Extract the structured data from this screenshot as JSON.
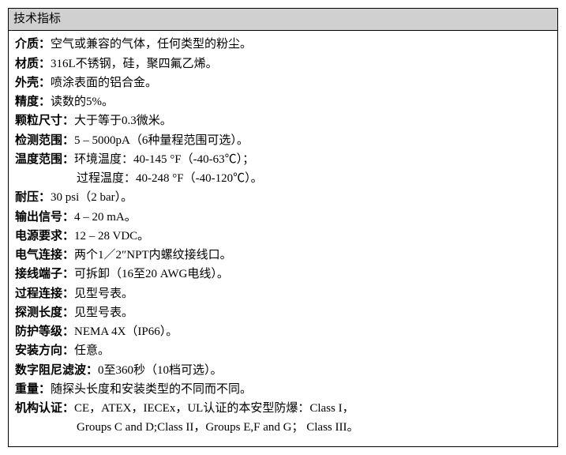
{
  "header": "技术指标",
  "specs": {
    "medium": {
      "label": "介质：",
      "value": "空气或兼容的气体，任何类型的粉尘。"
    },
    "material": {
      "label": "材质：",
      "value": "316L不锈钢，硅，聚四氟乙烯。"
    },
    "enclosure": {
      "label": "外壳：",
      "value": "喷涂表面的铝合金。"
    },
    "accuracy": {
      "label": "精度：",
      "value": "读数的5%。"
    },
    "particle": {
      "label": "颗粒尺寸：",
      "value": "大于等于0.3微米。"
    },
    "detection_range": {
      "label": "检测范围：",
      "value": "5 – 5000pA（6种量程范围可选）。"
    },
    "temp_range": {
      "label": "温度范围：",
      "value": "环境温度：40-145 °F（-40-63℃）；",
      "value2": "过程温度：40-248 °F（-40-120℃）。"
    },
    "pressure": {
      "label": "耐压：",
      "value": "30 psi（2 bar）。"
    },
    "output": {
      "label": "输出信号：",
      "value": "4 – 20 mA。"
    },
    "power": {
      "label": "电源要求：",
      "value": "12 – 28 VDC。"
    },
    "electrical": {
      "label": "电气连接：",
      "value": "两个1／2″NPT内螺纹接线口。"
    },
    "terminal": {
      "label": "接线端子：",
      "value": "可拆卸（16至20 AWG电线）。"
    },
    "process": {
      "label": "过程连接：",
      "value": "见型号表。"
    },
    "probe_length": {
      "label": "探测长度：",
      "value": "见型号表。"
    },
    "protection": {
      "label": "防护等级：",
      "value": "NEMA 4X（IP66）。"
    },
    "orientation": {
      "label": "安装方向：",
      "value": "任意。"
    },
    "damping": {
      "label": "数字阻尼滤波：",
      "value": "0至360秒（10档可选）。"
    },
    "weight": {
      "label": "重量：",
      "value": "随探头长度和安装类型的不同而不同。"
    },
    "certification": {
      "label": "机构认证：",
      "value": "CE，ATEX，IECEx，UL认证的本安型防爆：Class I，",
      "value2": "Groups C and D;Class II，Groups E,F and G； Class III。"
    }
  }
}
